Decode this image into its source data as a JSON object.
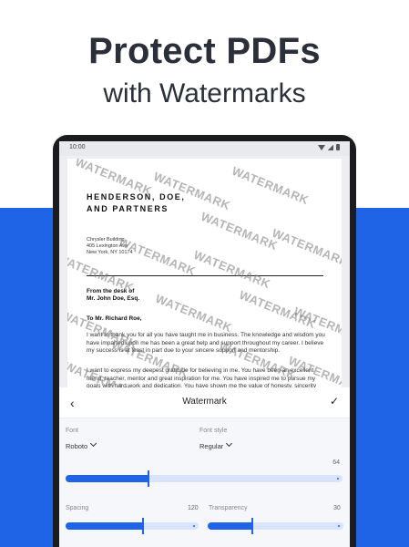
{
  "promo": {
    "title": "Protect PDFs",
    "subtitle": "with Watermarks"
  },
  "status_bar": {
    "time": "10:00"
  },
  "document": {
    "company_lines": [
      "HENDERSON, DOE,",
      "AND PARTNERS"
    ],
    "address_lines": [
      "Chrysler Building",
      "405 Lexington Ave",
      "New York, NY 10174"
    ],
    "desk_lines": [
      "From the desk of",
      "Mr. John Doe, Esq."
    ],
    "salutation": "To Mr. Richard Roe,",
    "paragraph_1": "I want to thank you for all you have taught me in business. The knowledge and wisdom you have imparted upon me has been a great help and support throughout my career. I believe my success is at least in part due to your sincere support and mentorship.",
    "paragraph_2": "I want to express my deepest gratitude for believing in me. You have been an excellent friend, teacher, mentor and great inspiration for me. You have inspired me to pursue my goals with hard work and dedication. You have shown me the value of honesty, sincerity and trust in business.",
    "watermark_text": "WATERMARK"
  },
  "toolbar": {
    "title": "Watermark",
    "back_icon": "chevron-left-icon",
    "confirm_icon": "check-icon"
  },
  "settings": {
    "font_label": "Font",
    "font_value": "Roboto",
    "font_style_label": "Font style",
    "font_style_value": "Regular",
    "size_value": "64",
    "size_fraction": 0.3,
    "spacing_label": "Spacing",
    "spacing_value": "120",
    "spacing_fraction": 0.58,
    "transparency_label": "Transparency",
    "transparency_value": "30",
    "transparency_fraction": 0.33
  },
  "colors": {
    "accent": "#1f63e6",
    "track": "#d7e4fb",
    "headline": "#2b2f3a"
  }
}
